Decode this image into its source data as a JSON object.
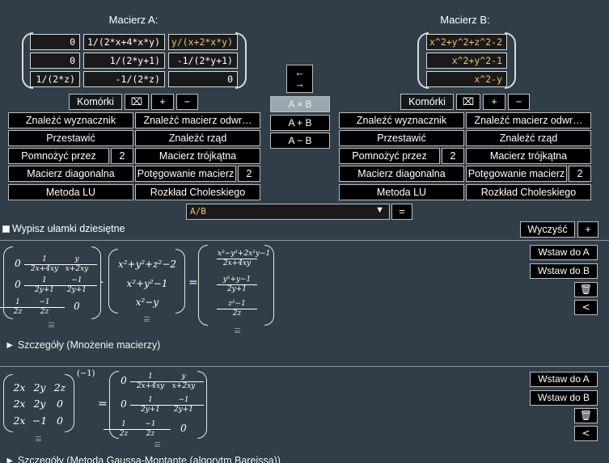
{
  "matrixA": {
    "title": "Macierz A:",
    "rows": [
      [
        "0",
        "1/(2*x+4*x*y)",
        "y/(x+2*x*y)"
      ],
      [
        "0",
        "1/(2*y+1)",
        "-1/(2*y+1)"
      ],
      [
        "1/(2*z)",
        "-1/(2*z)",
        "0"
      ]
    ]
  },
  "matrixB": {
    "title": "Macierz B:",
    "rows": [
      [
        "x^2+y^2+z^2-2"
      ],
      [
        "x^2+y^2-1"
      ],
      [
        "x^2-y"
      ]
    ]
  },
  "cells_button": "Komórki",
  "plus": "+",
  "minus": "−",
  "swap_arrows": {
    "left": "←",
    "right": "→"
  },
  "ops": {
    "mul": "A × B",
    "add": "A + B",
    "sub": "A − B"
  },
  "actions": {
    "determinant": "Znaleźć wyznacznik",
    "inverse": "Znaleźć macierz odwr…",
    "transpose": "Przestawić",
    "rank": "Znaleźć rząd",
    "multiply_by": "Pomnożyć przez",
    "multiply_value": "2",
    "triangular": "Macierz trójkątna",
    "diagonal": "Macierz diagonalna",
    "power": "Potęgowanie macierz",
    "power_value": "2",
    "lu": "Metoda LU",
    "cholesky": "Rozkład Choleskiego"
  },
  "expression": {
    "value": "A/B",
    "eq": "="
  },
  "decimals_label": "Wypisz ułamki dziesiętne",
  "clear_button": "Wyczyść",
  "add_button": "+",
  "insert_a": "Wstaw do A",
  "insert_b": "Wstaw do B",
  "result1": {
    "left": [
      [
        {
          "t": "0"
        },
        {
          "n": "1",
          "d": "2x+4xy"
        },
        {
          "n": "y",
          "d": "x+2xy"
        }
      ],
      [
        {
          "t": "0"
        },
        {
          "n": "1",
          "d": "2y+1"
        },
        {
          "n": "−1",
          "d": "2y+1"
        }
      ],
      [
        {
          "n": "1",
          "d": "2z"
        },
        {
          "n": "−1",
          "d": "2z"
        },
        {
          "t": "0"
        }
      ]
    ],
    "middle": [
      "x²+y²+z²−2",
      "x²+y²−1",
      "x²−y"
    ],
    "right": [
      {
        "n": "x²−y²+2x²y−1",
        "d": "2x+4xy"
      },
      {
        "n": "y²+y−1",
        "d": "2y+1"
      },
      {
        "n": "z²−1",
        "d": "2z"
      }
    ],
    "dot": "·",
    "equals": "=",
    "details": "► Szczegóły (Mnożenie macierzy)"
  },
  "result2": {
    "left": [
      [
        "2x",
        "2y",
        "2z"
      ],
      [
        "2x",
        "2y",
        "0"
      ],
      [
        "2x",
        "−1",
        "0"
      ]
    ],
    "exponent": "(−1)",
    "equals": "=",
    "right": [
      [
        {
          "t": "0"
        },
        {
          "n": "1",
          "d": "2x+4xy"
        },
        {
          "n": "y",
          "d": "x+2xy"
        }
      ],
      [
        {
          "t": "0"
        },
        {
          "n": "1",
          "d": "2y+1"
        },
        {
          "n": "−1",
          "d": "2y+1"
        }
      ],
      [
        {
          "n": "1",
          "d": "2z"
        },
        {
          "n": "−1",
          "d": "2z"
        },
        {
          "t": "0"
        }
      ]
    ],
    "details": "► Szczegóły (Metoda Gaussa-Montante (algorytm Bareissa))"
  }
}
